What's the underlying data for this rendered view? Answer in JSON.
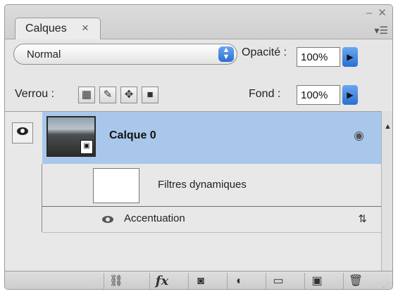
{
  "panel": {
    "tab_label": "Calques",
    "tab_close_icon": "close-icon",
    "window_controls": "– ✕",
    "menu_icon": "panel-menu-icon"
  },
  "blend": {
    "value": "Normal"
  },
  "opacity": {
    "label": "Opacité :",
    "value": "100%"
  },
  "lock": {
    "label": "Verrou :"
  },
  "fill": {
    "label": "Fond :",
    "value": "100%"
  },
  "layers": {
    "layer0": {
      "name": "Calque 0",
      "visible": true,
      "smart_object": true
    },
    "filters_label": "Filtres dynamiques",
    "effect_label": "Accentuation"
  },
  "colors": {
    "selection": "#a9c7ea",
    "accent": "#2c6fd2",
    "panel_bg": "#e6e6e6"
  }
}
